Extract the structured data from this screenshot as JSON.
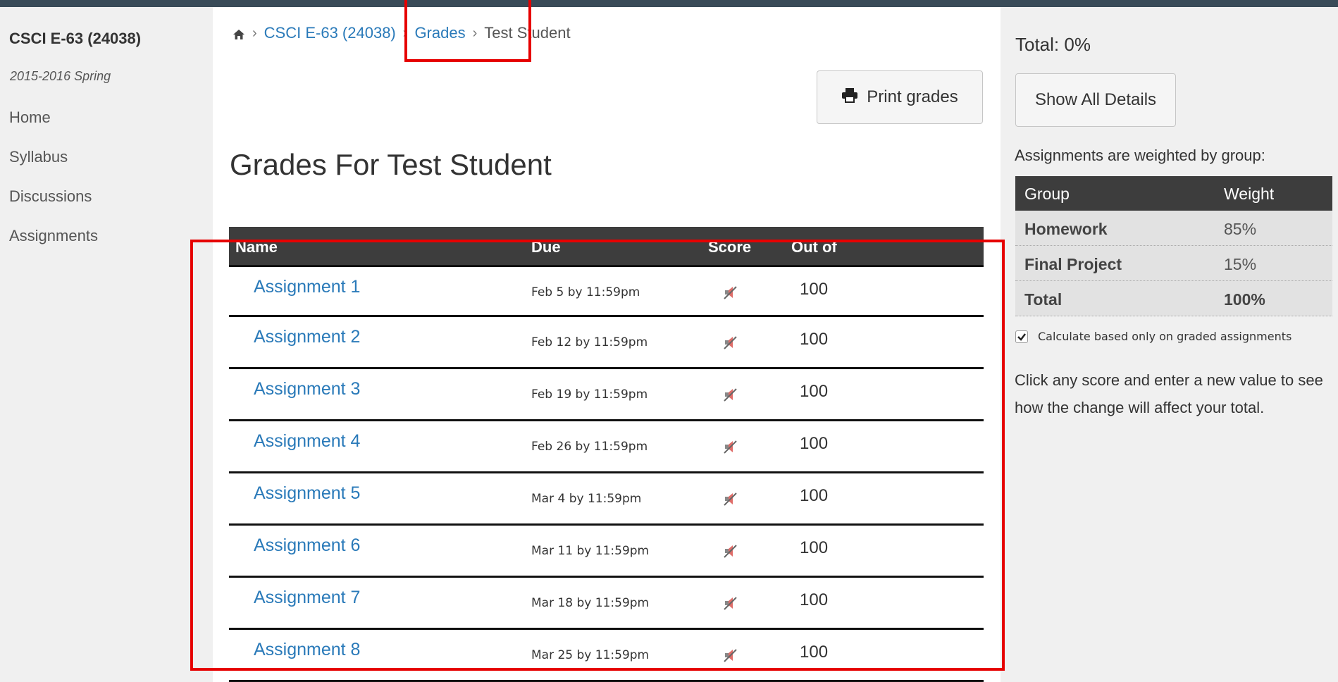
{
  "course": {
    "title": "CSCI E-63 (24038)",
    "term": "2015-2016 Spring",
    "nav": [
      "Home",
      "Syllabus",
      "Discussions",
      "Assignments"
    ]
  },
  "breadcrumb": {
    "home_icon": "home-icon",
    "course": "CSCI E-63 (24038)",
    "grades": "Grades",
    "current": "Test Student"
  },
  "toolbar": {
    "print_label": "Print grades",
    "print_icon": "printer-icon"
  },
  "page": {
    "title": "Grades For Test Student"
  },
  "grades_table": {
    "headers": [
      "Name",
      "Due",
      "Score",
      "Out of"
    ],
    "rows": [
      {
        "name": "Assignment 1",
        "due": "Feb 5 by 11:59pm",
        "out_of": "100"
      },
      {
        "name": "Assignment 2",
        "due": "Feb 12 by 11:59pm",
        "out_of": "100"
      },
      {
        "name": "Assignment 3",
        "due": "Feb 19 by 11:59pm",
        "out_of": "100"
      },
      {
        "name": "Assignment 4",
        "due": "Feb 26 by 11:59pm",
        "out_of": "100"
      },
      {
        "name": "Assignment 5",
        "due": "Mar 4 by 11:59pm",
        "out_of": "100"
      },
      {
        "name": "Assignment 6",
        "due": "Mar 11 by 11:59pm",
        "out_of": "100"
      },
      {
        "name": "Assignment 7",
        "due": "Mar 18 by 11:59pm",
        "out_of": "100"
      },
      {
        "name": "Assignment 8",
        "due": "Mar 25 by 11:59pm",
        "out_of": "100"
      }
    ],
    "score_icon": "muted-icon"
  },
  "summary": {
    "total": "Total: 0%",
    "show_details": "Show All Details",
    "weight_note": "Assignments are weighted by group:",
    "weight_headers": [
      "Group",
      "Weight"
    ],
    "weights": [
      {
        "group": "Homework",
        "weight": "85%"
      },
      {
        "group": "Final Project",
        "weight": "15%"
      },
      {
        "group": "Total",
        "weight": "100%"
      }
    ],
    "calc_label": "Calculate based only on graded assignments",
    "calc_checked": true,
    "help_text": "Click any score and enter a new value to see how the change will affect your total."
  },
  "colors": {
    "link": "#2a7ab9",
    "table_header": "#3d3d3d",
    "highlight": "#e60000",
    "topbar": "#394b58"
  }
}
